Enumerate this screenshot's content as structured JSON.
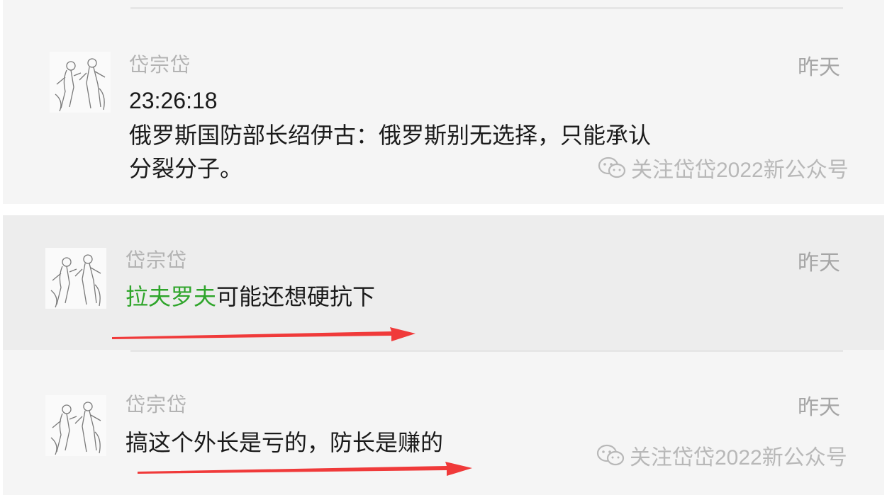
{
  "messages": [
    {
      "sender": "岱宗岱",
      "time": "昨天",
      "line1": "23:26:18",
      "line2": "俄罗斯国防部长绍伊古：俄罗斯别无选择，只能承认",
      "line3": "分裂分子。"
    },
    {
      "sender": "岱宗岱",
      "time": "昨天",
      "mention": "拉夫罗夫",
      "text": "可能还想硬抗下"
    },
    {
      "sender": "岱宗岱",
      "time": "昨天",
      "text": "搞这个外长是亏的，防长是赚的"
    }
  ],
  "watermark": {
    "text": "关注岱岱2022新公众号",
    "icon": "wechat-icon"
  },
  "colors": {
    "mention": "#2fa52b",
    "arrow": "#f03a3a"
  }
}
